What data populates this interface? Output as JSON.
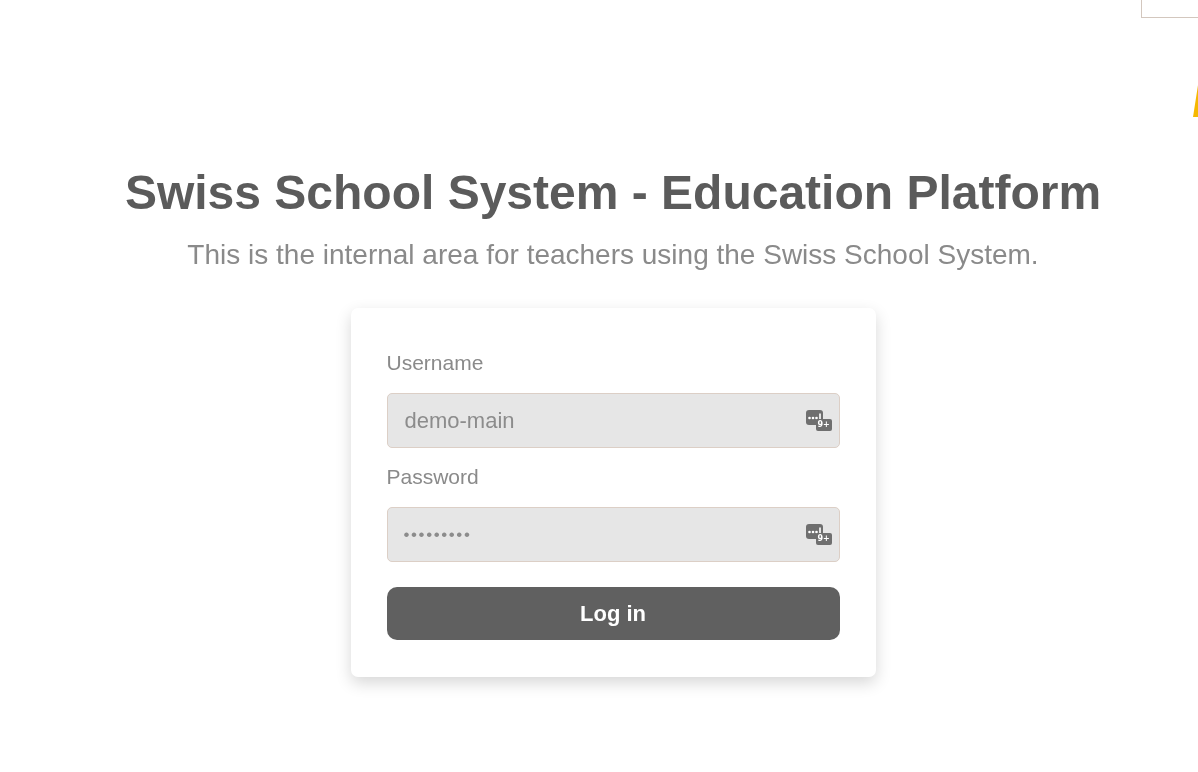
{
  "header": {
    "title": "Swiss School System - Education Platform",
    "subtitle": "This is the internal area for teachers using the Swiss School System."
  },
  "login_form": {
    "fields": [
      {
        "label": "Username",
        "kind": "text",
        "value": "demo-main",
        "badge": "9+"
      },
      {
        "label": "Password",
        "kind": "password",
        "value": "•••••••••",
        "badge": "9+"
      }
    ],
    "submit_button": "Log in"
  }
}
